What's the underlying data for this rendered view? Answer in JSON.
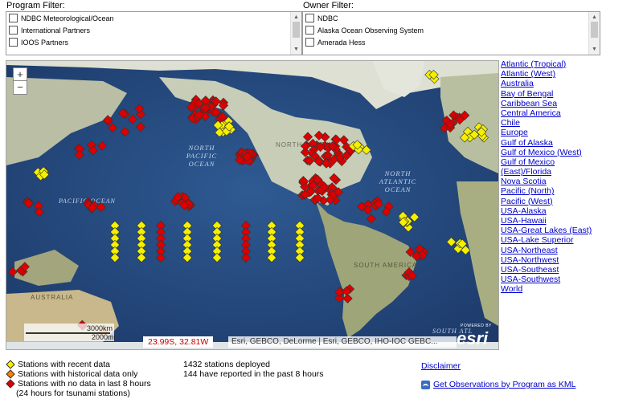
{
  "program_filter": {
    "label": "Program Filter:",
    "items": [
      "NDBC Meteorological/Ocean",
      "International Partners",
      "IOOS Partners"
    ]
  },
  "owner_filter": {
    "label": "Owner Filter:",
    "items": [
      "NDBC",
      "Alaska Ocean Observing System",
      "Amerada Hess"
    ]
  },
  "map": {
    "zoom_in": "+",
    "zoom_out": "−",
    "ocean_labels": {
      "north_pacific": "NORTH PACIFIC OCEAN",
      "north_atlantic": "NORTH ATLANTIC OCEAN",
      "pacific_west": "PACIFIC OCEAN",
      "north_america": "NORTH AMERICA",
      "south_america": "SOUTH AMERICA",
      "australia": "AUSTRALIA",
      "south_atlantic": "SOUTH ATL"
    },
    "coords": "23.99S, 32.81W",
    "attribution": "Esri, GEBCO, DeLorme | Esri, GEBCO, IHO-IOC GEBC...",
    "esri_powered": "POWERED BY",
    "esri_logo": "esri",
    "scale_km": "3000km",
    "scale_mi": "2000mi"
  },
  "regions": [
    "Atlantic (Tropical)",
    "Atlantic (West)",
    "Australia",
    "Bay of Bengal",
    "Caribbean Sea",
    "Central America",
    "Chile",
    "Europe",
    "Gulf of Alaska",
    "Gulf of Mexico (West)",
    "Gulf of Mexico",
    "(East)/Florida",
    "Nova Scotia",
    "Pacific (North)",
    "Pacific (West)",
    "USA-Alaska",
    "USA-Hawaii",
    "USA-Great Lakes (East)",
    "USA-Lake Superior",
    "USA-Northeast",
    "USA-Northwest",
    "USA-Southeast",
    "USA-Southwest",
    "World"
  ],
  "legend": {
    "recent": "Stations with recent data",
    "historical": "Stations with historical data only",
    "no_data": "Stations with no data in last 8 hours",
    "no_data_note": "(24 hours for tsunami stations)",
    "colors": {
      "recent": "#f5f000",
      "historical": "#ff7f00",
      "no_data": "#dd0000"
    }
  },
  "stats": {
    "deployed": "1432 stations deployed",
    "reported": "144 have reported in the past 8 hours"
  },
  "links": {
    "disclaimer": "Disclaimer",
    "kml": "Get Observations by Program as KML"
  }
}
